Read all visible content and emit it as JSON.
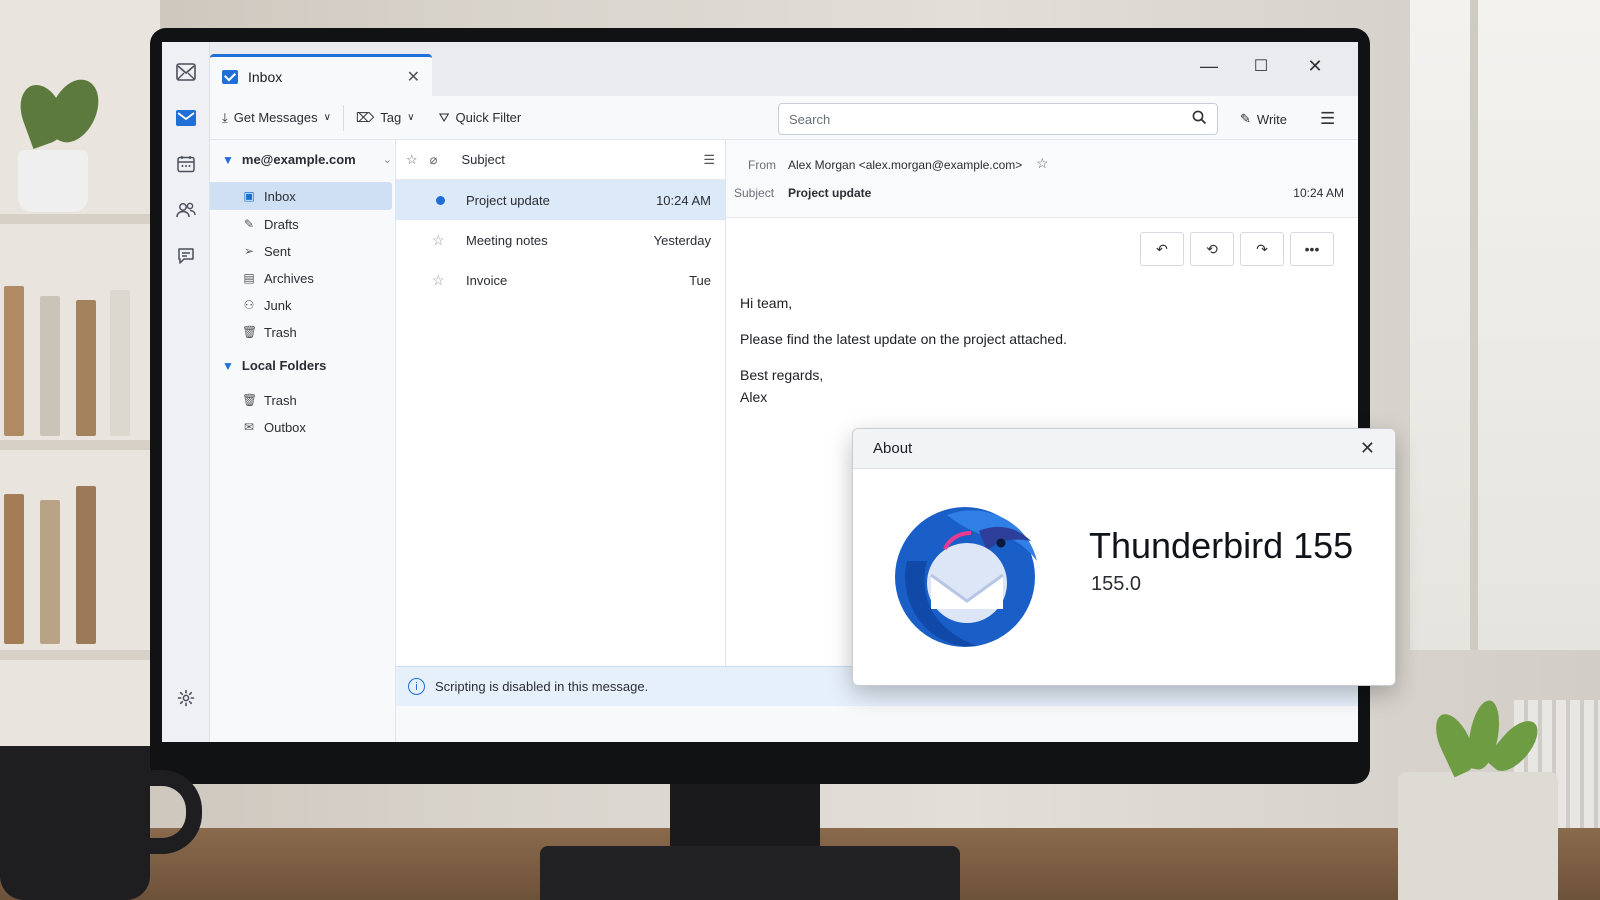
{
  "app": {
    "tab_title": "Inbox",
    "window_controls": {
      "minimize": "—",
      "maximize": "☐",
      "close": "✕"
    }
  },
  "spaces": [
    {
      "name": "mail-space-icon"
    },
    {
      "name": "mail-active-icon"
    },
    {
      "name": "calendar-icon"
    },
    {
      "name": "address-book-icon"
    },
    {
      "name": "chat-icon"
    },
    {
      "name": "settings-icon"
    }
  ],
  "toolbar": {
    "get_messages": "Get Messages",
    "tag": "Tag",
    "quick_filter": "Quick Filter",
    "search_placeholder": "Search",
    "write": "Write"
  },
  "folders": {
    "account": "me@example.com",
    "account_folders": [
      {
        "label": "Inbox",
        "icon": "inbox-icon",
        "selected": true
      },
      {
        "label": "Drafts",
        "icon": "drafts-icon"
      },
      {
        "label": "Sent",
        "icon": "sent-icon"
      },
      {
        "label": "Archives",
        "icon": "archive-icon"
      },
      {
        "label": "Junk",
        "icon": "junk-icon"
      },
      {
        "label": "Trash",
        "icon": "trash-icon"
      }
    ],
    "local_label": "Local Folders",
    "local_folders": [
      {
        "label": "Trash",
        "icon": "trash-icon"
      },
      {
        "label": "Outbox",
        "icon": "outbox-icon"
      }
    ]
  },
  "message_list": {
    "header_subject": "Subject",
    "rows": [
      {
        "subject": "Project update",
        "date": "10:24 AM",
        "unread": true,
        "selected": true
      },
      {
        "subject": "Meeting notes",
        "date": "Yesterday"
      },
      {
        "subject": "Invoice",
        "date": "Tue"
      }
    ]
  },
  "reader": {
    "from_label": "From",
    "from_value": "Alex Morgan <alex.morgan@example.com>",
    "subject_label": "Subject",
    "subject_value": "Project update",
    "time": "10:24 AM",
    "body": {
      "greeting": "Hi team,",
      "line1": "Please find the latest update on the project attached.",
      "signoff": "Best regards,",
      "name": "Alex"
    }
  },
  "notice": "Scripting is disabled in this message.",
  "about": {
    "title": "About",
    "product": "Thunderbird 155",
    "version": "155.0"
  },
  "colors": {
    "accent": "#1f6fd6",
    "selection": "#cfe0f5"
  }
}
